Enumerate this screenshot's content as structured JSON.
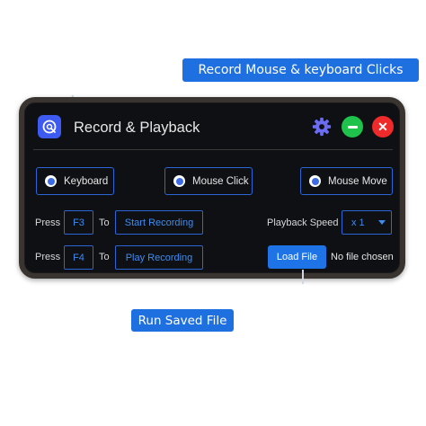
{
  "callouts": {
    "top": "Record Mouse & keyboard Clicks",
    "bottom": "Run Saved File"
  },
  "app": {
    "title": "Record & Playback",
    "icons": {
      "app": "record-playback-icon",
      "settings": "gear-icon",
      "minimize": "minimize-icon",
      "close": "close-icon"
    }
  },
  "modes": [
    {
      "label": "Keyboard"
    },
    {
      "label": "Mouse Click"
    },
    {
      "label": "Mouse Move"
    }
  ],
  "hotkeys": {
    "record": {
      "press": "Press",
      "key": "F3",
      "to": "To",
      "action": "Start Recording"
    },
    "play": {
      "press": "Press",
      "key": "F4",
      "to": "To",
      "action": "Play Recording"
    }
  },
  "playback": {
    "label": "Playback Speed",
    "value": "x 1"
  },
  "file": {
    "button": "Load File",
    "status": "No file chosen"
  },
  "colors": {
    "accent": "#1e6fe0",
    "window_bg": "#0e1014",
    "minimize": "#1fc24a",
    "close": "#ee2a2a",
    "gear": "#6b6cf2"
  }
}
